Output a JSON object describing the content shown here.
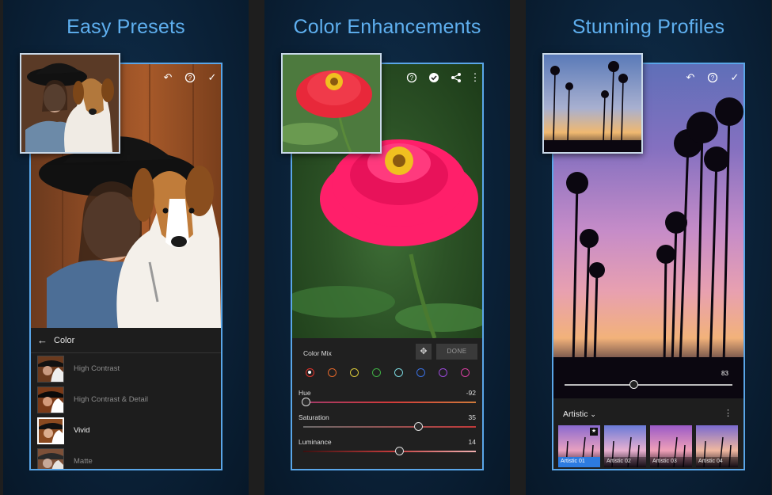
{
  "panels": [
    {
      "title": "Easy Presets"
    },
    {
      "title": "Color Enhancements"
    },
    {
      "title": "Stunning Profiles"
    }
  ],
  "presets_screen": {
    "header": "Color",
    "items": [
      {
        "label": "High Contrast",
        "selected": false
      },
      {
        "label": "High Contrast & Detail",
        "selected": false
      },
      {
        "label": "Vivid",
        "selected": true
      },
      {
        "label": "Matte",
        "selected": false
      }
    ]
  },
  "color_mix": {
    "title": "Color Mix",
    "done_label": "DONE",
    "swatches": [
      {
        "color": "#e2342c",
        "selected": true
      },
      {
        "color": "#e0662a",
        "selected": false
      },
      {
        "color": "#d7c63a",
        "selected": false
      },
      {
        "color": "#3fae44",
        "selected": false
      },
      {
        "color": "#7ad6dc",
        "selected": false
      },
      {
        "color": "#3a6fe0",
        "selected": false
      },
      {
        "color": "#9a48d8",
        "selected": false
      },
      {
        "color": "#d43e9e",
        "selected": false
      }
    ],
    "sliders": [
      {
        "label": "Hue",
        "value": "-92"
      },
      {
        "label": "Saturation",
        "value": "35"
      },
      {
        "label": "Luminance",
        "value": "14"
      }
    ]
  },
  "profiles_screen": {
    "slider_value": "83",
    "group_label": "Artistic",
    "profiles": [
      {
        "label": "Artistic 01",
        "selected": true
      },
      {
        "label": "Artistic 02",
        "selected": false
      },
      {
        "label": "Artistic 03",
        "selected": false
      },
      {
        "label": "Artistic 04",
        "selected": false
      }
    ]
  }
}
